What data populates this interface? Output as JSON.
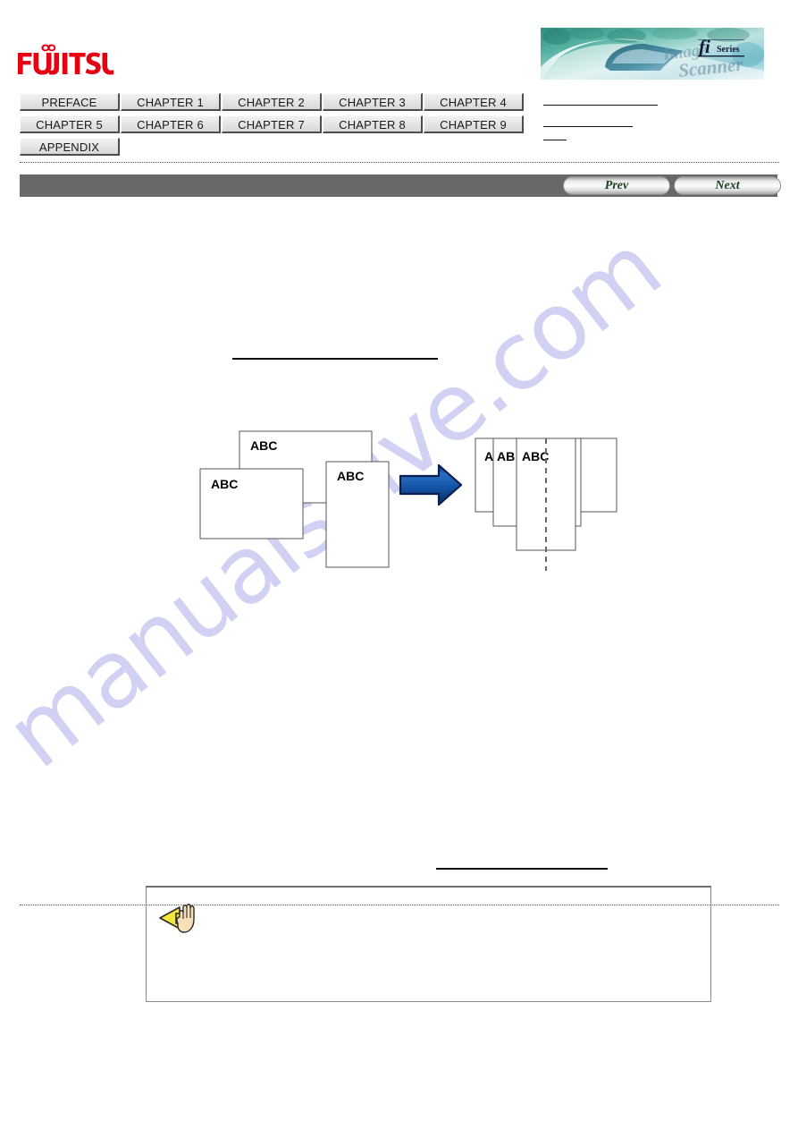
{
  "header": {
    "logo_text": "FUJITSU",
    "logo_color": "#e60012",
    "banner": {
      "product_name": "fi",
      "series_label": "Series",
      "script_text": "Image Scanner",
      "alt": "fi Series Image Scanner banner"
    }
  },
  "chapter_nav": {
    "rows": [
      [
        "PREFACE",
        "CHAPTER 1",
        "CHAPTER 2",
        "CHAPTER 3",
        "CHAPTER 4"
      ],
      [
        "CHAPTER 5",
        "CHAPTER 6",
        "CHAPTER 7",
        "CHAPTER 8",
        "CHAPTER 9"
      ],
      [
        "APPENDIX"
      ]
    ]
  },
  "toolbar": {
    "prev_label": "Prev",
    "next_label": "Next",
    "background_color": "#686868"
  },
  "content": {
    "heading_text": "",
    "footer_text": "",
    "note": {
      "icon": "attention-hand-icon",
      "text": ""
    },
    "diagram": {
      "type": "document-alignment-illustration",
      "left_group_label": "ABC",
      "right_group_label": "ABC",
      "arrow_color": "#1b57a8",
      "center_line_style": "dashed",
      "pages": [
        {
          "label": "ABC"
        },
        {
          "label": "ABC"
        },
        {
          "label": "ABC"
        }
      ]
    }
  },
  "watermark": {
    "text": "manualshive.com",
    "color": "#c9c9f2"
  }
}
